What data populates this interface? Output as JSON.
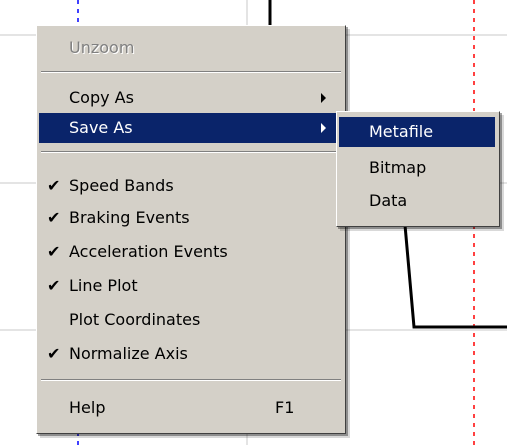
{
  "context_menu": {
    "items": {
      "unzoom": "Unzoom",
      "copy_as": "Copy As",
      "save_as": "Save As",
      "speed_bands": "Speed Bands",
      "braking_events": "Braking Events",
      "acceleration_events": "Acceleration Events",
      "line_plot": "Line Plot",
      "plot_coordinates": "Plot Coordinates",
      "normalize_axis": "Normalize Axis",
      "help": "Help"
    },
    "help_shortcut": "F1",
    "check_glyph": "✔"
  },
  "submenu": {
    "metafile": "Metafile",
    "bitmap": "Bitmap",
    "data": "Data"
  },
  "colors": {
    "menu_bg": "#d4d0c8",
    "highlight": "#0a246a",
    "grid": "#c8c8c8",
    "blue_marker": "#0000ff",
    "red_marker": "#ff0000"
  }
}
